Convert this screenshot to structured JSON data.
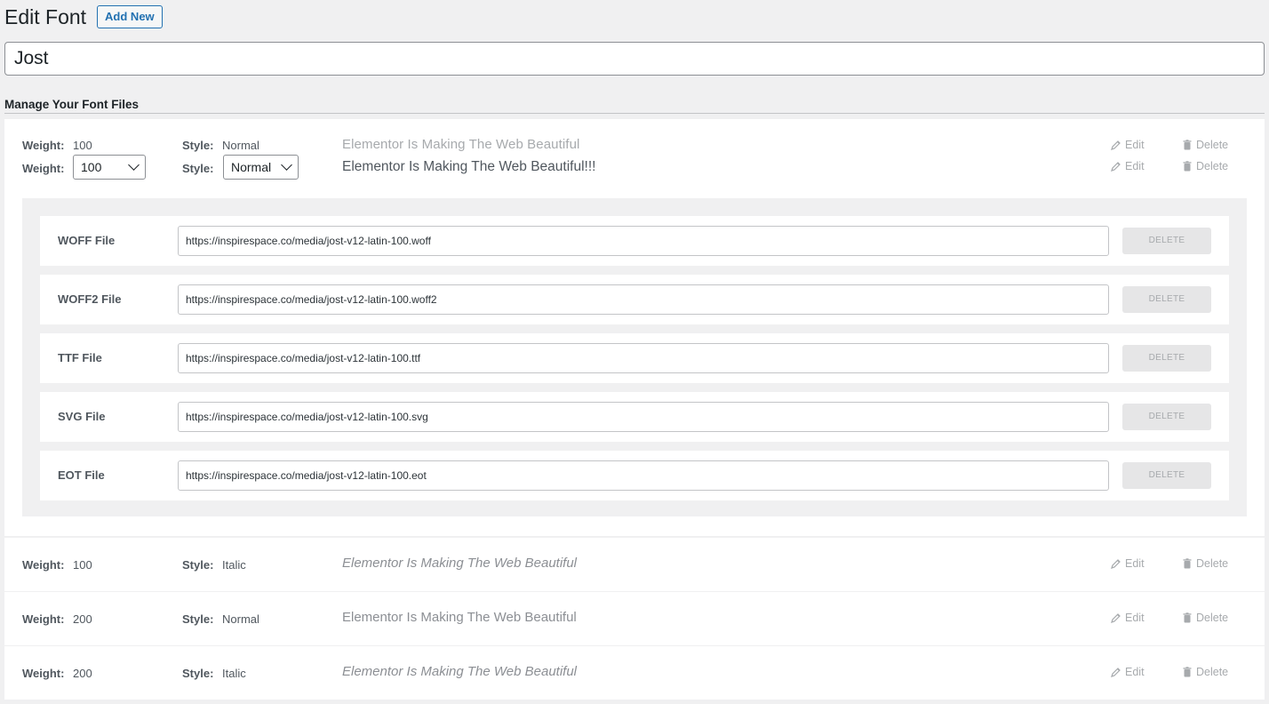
{
  "header": {
    "title": "Edit Font",
    "add_new": "Add New"
  },
  "font_name": "Jost",
  "section_title": "Manage Your Font Files",
  "labels": {
    "weight": "Weight:",
    "style": "Style:",
    "edit": "Edit",
    "delete": "Delete"
  },
  "expanded": {
    "weight": "100",
    "style": "Normal",
    "weight_select": "100",
    "style_select": "Normal",
    "preview_light": "Elementor Is Making The Web Beautiful",
    "preview_bold": "Elementor Is Making The Web Beautiful!!!",
    "files": [
      {
        "label": "WOFF File",
        "url": "https://inspirespace.co/media/jost-v12-latin-100.woff",
        "delete": "DELETE"
      },
      {
        "label": "WOFF2 File",
        "url": "https://inspirespace.co/media/jost-v12-latin-100.woff2",
        "delete": "DELETE"
      },
      {
        "label": "TTF File",
        "url": "https://inspirespace.co/media/jost-v12-latin-100.ttf",
        "delete": "DELETE"
      },
      {
        "label": "SVG File",
        "url": "https://inspirespace.co/media/jost-v12-latin-100.svg",
        "delete": "DELETE"
      },
      {
        "label": "EOT File",
        "url": "https://inspirespace.co/media/jost-v12-latin-100.eot",
        "delete": "DELETE"
      }
    ]
  },
  "variants": [
    {
      "weight": "100",
      "style": "Italic",
      "preview": "Elementor Is Making The Web Beautiful"
    },
    {
      "weight": "200",
      "style": "Normal",
      "preview": "Elementor Is Making The Web Beautiful"
    },
    {
      "weight": "200",
      "style": "Italic",
      "preview": "Elementor Is Making The Web Beautiful"
    }
  ],
  "colors": {
    "accent": "#2271b1",
    "muted": "#a7aaad",
    "panel": "#f0f0f1"
  },
  "icons": {
    "edit": "pencil-icon",
    "delete": "trash-icon",
    "select": "chevron-down-icon"
  }
}
